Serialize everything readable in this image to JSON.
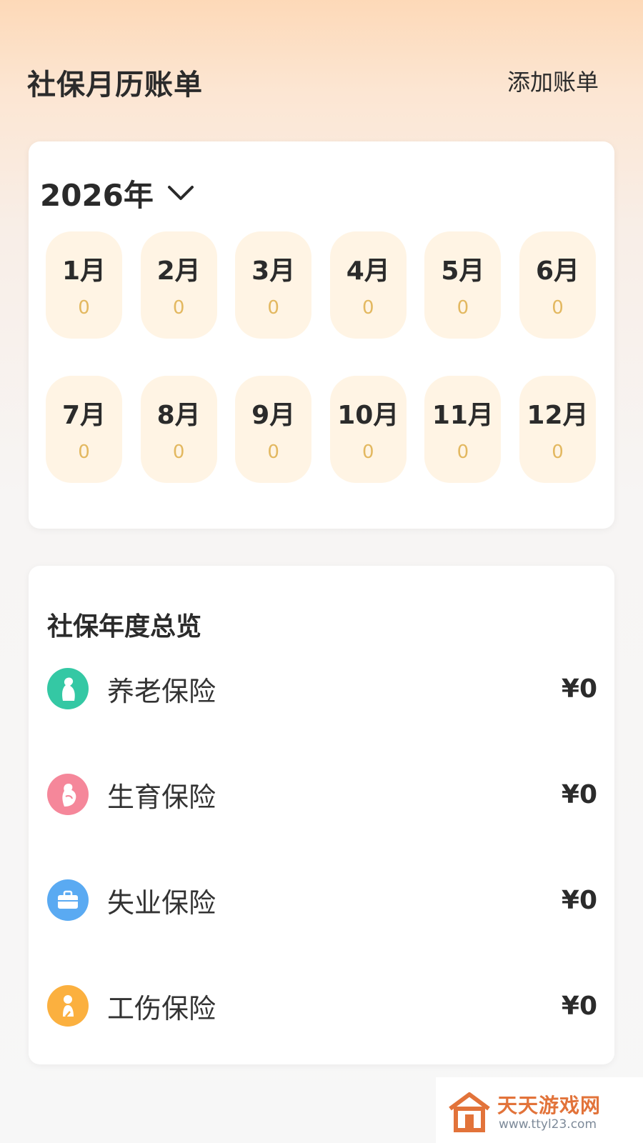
{
  "header": {
    "title": "社保月历账单",
    "add_bill_label": "添加账单"
  },
  "calendar": {
    "year_label": "2026年",
    "months": [
      {
        "label": "1月",
        "count": "0"
      },
      {
        "label": "2月",
        "count": "0"
      },
      {
        "label": "3月",
        "count": "0"
      },
      {
        "label": "4月",
        "count": "0"
      },
      {
        "label": "5月",
        "count": "0"
      },
      {
        "label": "6月",
        "count": "0"
      },
      {
        "label": "7月",
        "count": "0"
      },
      {
        "label": "8月",
        "count": "0"
      },
      {
        "label": "9月",
        "count": "0"
      },
      {
        "label": "10月",
        "count": "0"
      },
      {
        "label": "11月",
        "count": "0"
      },
      {
        "label": "12月",
        "count": "0"
      }
    ]
  },
  "overview": {
    "title": "社保年度总览",
    "items": [
      {
        "name": "养老保险",
        "amount": "¥0",
        "icon": "elderly-icon",
        "color": "#34c8a4"
      },
      {
        "name": "生育保险",
        "amount": "¥0",
        "icon": "maternity-icon",
        "color": "#f5879a"
      },
      {
        "name": "失业保险",
        "amount": "¥0",
        "icon": "briefcase-icon",
        "color": "#5aaaf2"
      },
      {
        "name": "工伤保险",
        "amount": "¥0",
        "icon": "injury-icon",
        "color": "#fbb03f"
      }
    ]
  },
  "watermark": {
    "brand": "天天游戏网",
    "url": "www.ttyl23.com"
  }
}
